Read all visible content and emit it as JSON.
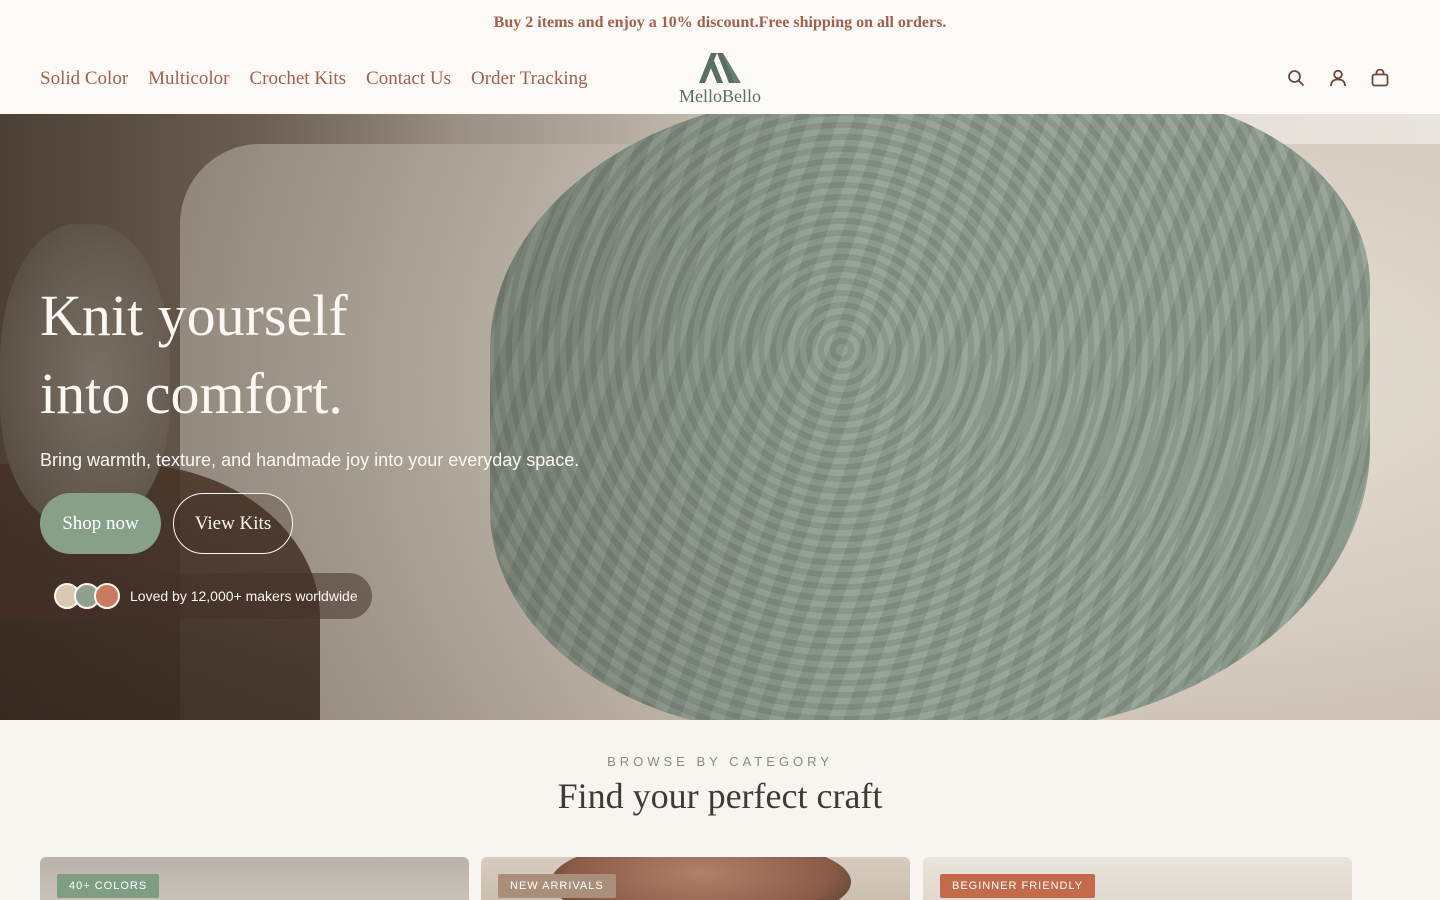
{
  "announcement": "Buy 2 items and enjoy a 10% discount.Free shipping on all orders.",
  "nav": {
    "items": [
      {
        "label": "Solid Color"
      },
      {
        "label": "Multicolor"
      },
      {
        "label": "Crochet Kits"
      },
      {
        "label": "Contact Us"
      },
      {
        "label": "Order Tracking"
      }
    ]
  },
  "brand": {
    "name": "MelloBello"
  },
  "header_icons": [
    "search-icon",
    "account-icon",
    "cart-icon"
  ],
  "hero": {
    "title_line1": "Knit yourself",
    "title_line2": "into comfort.",
    "subtitle": "Bring warmth, texture, and handmade joy into your everyday space.",
    "primary_button": "Shop now",
    "secondary_button": "View Kits",
    "social_proof": "Loved by 12,000+ makers worldwide",
    "swatch_colors": [
      "#d8c9b0",
      "#8fa08f",
      "#c97c5d"
    ]
  },
  "browse": {
    "eyebrow": "BROWSE BY CATEGORY",
    "title": "Find your perfect craft",
    "cards": [
      {
        "badge": "40+ COLORS"
      },
      {
        "badge": "NEW ARRIVALS"
      },
      {
        "badge": "BEGINNER FRIENDLY"
      }
    ]
  },
  "colors": {
    "accent": "#a0614d",
    "brand_green": "#58705f",
    "button_green": "#88a088",
    "background": "#f8f4f0"
  }
}
